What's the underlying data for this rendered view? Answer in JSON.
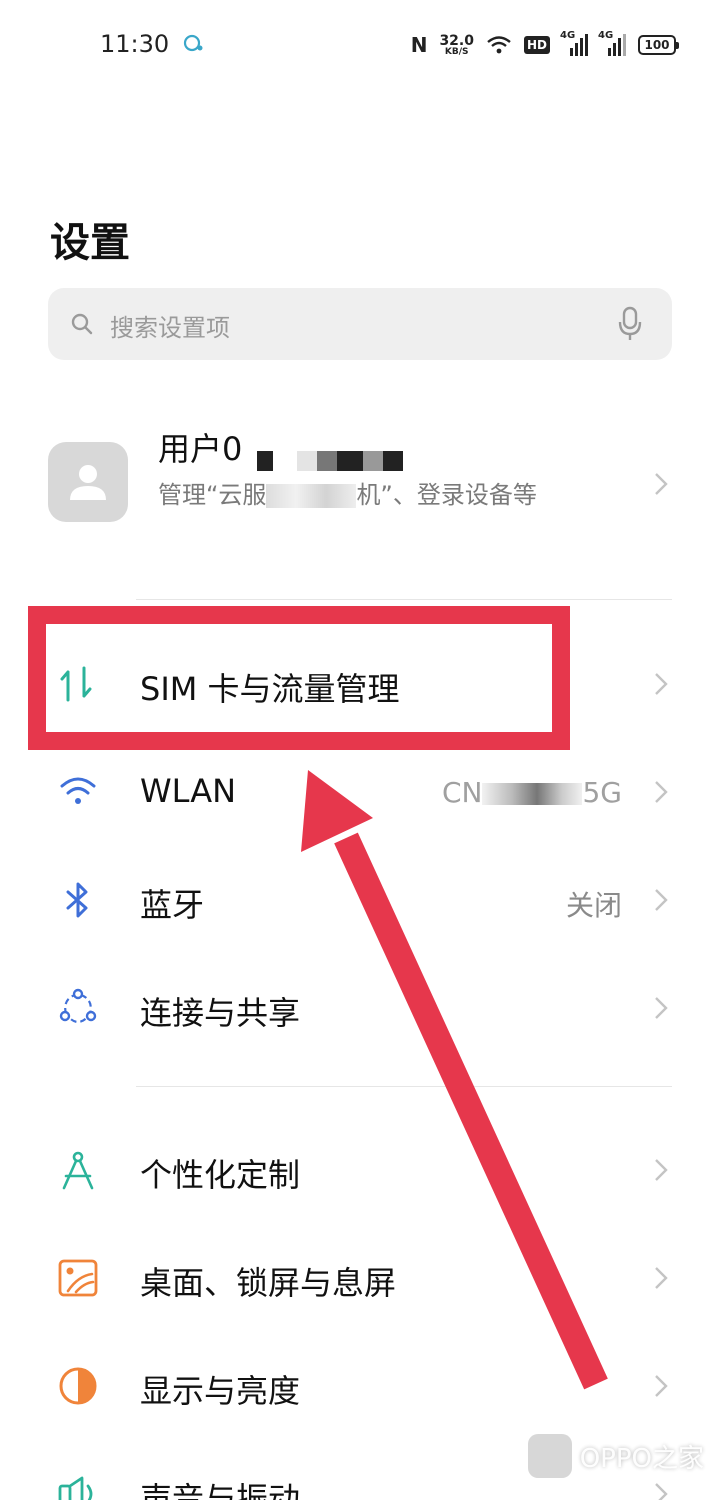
{
  "status_bar": {
    "time": "11:30",
    "nfc": "N",
    "speed_value": "32.0",
    "speed_unit": "KB/S",
    "hd": "HD",
    "sim1": "4G",
    "sim2": "4G",
    "battery": "100"
  },
  "page": {
    "title": "设置"
  },
  "search": {
    "placeholder": "搜索设置项"
  },
  "account": {
    "name": "用户0",
    "subtitle_start": "管理“云服",
    "subtitle_end": "机”、登录设备等"
  },
  "rows": [
    {
      "label": "SIM 卡与流量管理",
      "icon": "data-arrows-icon",
      "value": ""
    },
    {
      "label": "WLAN",
      "icon": "wifi-icon",
      "value_start": "CN",
      "value_end": "5G"
    },
    {
      "label": "蓝牙",
      "icon": "bluetooth-icon",
      "value": "关闭"
    },
    {
      "label": "连接与共享",
      "icon": "connection-share-icon",
      "value": ""
    },
    {
      "label": "个性化定制",
      "icon": "personalize-icon",
      "value": ""
    },
    {
      "label": "桌面、锁屏与息屏",
      "icon": "wallpaper-icon",
      "value": ""
    },
    {
      "label": "显示与亮度",
      "icon": "display-brightness-icon",
      "value": ""
    },
    {
      "label": "声音与振动",
      "icon": "sound-icon",
      "value": ""
    }
  ],
  "colors": {
    "accent_red": "#e6374c",
    "teal": "#2bb39a",
    "blue": "#3f6fd8",
    "orange": "#f0843a"
  },
  "watermark": {
    "text": "OPPO之家"
  }
}
